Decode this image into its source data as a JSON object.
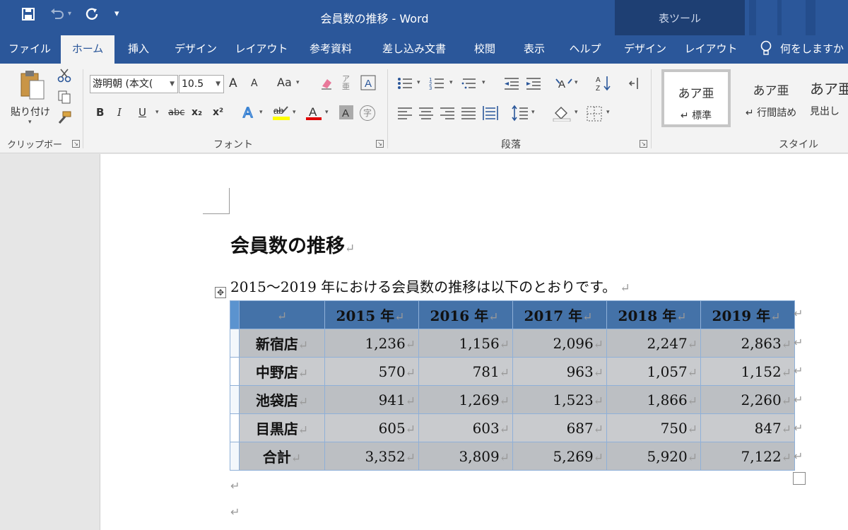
{
  "window": {
    "title": "会員数の推移  -  Word",
    "table_tools_label": "表ツール",
    "quick_access": {
      "save_icon": "save-icon",
      "undo_icon": "undo-icon",
      "redo_icon": "redo-icon",
      "customize_icon": "customize-icon"
    }
  },
  "tabs": [
    "ファイル",
    "ホーム",
    "挿入",
    "デザイン",
    "レイアウト",
    "参考資料",
    "差し込み文書",
    "校閲",
    "表示",
    "ヘルプ",
    "デザイン",
    "レイアウト"
  ],
  "active_tab": "ホーム",
  "tell_me": "何をしますか",
  "ribbon": {
    "clipboard": {
      "paste_label": "貼り付け",
      "group_label": "クリップボード"
    },
    "font": {
      "font_name": "游明朝 (本文(",
      "font_size": "10.5",
      "group_label": "フォント",
      "grow": "A",
      "shrink": "A",
      "change_case": "Aa",
      "bold": "B",
      "italic": "I",
      "underline": "U",
      "strike": "abc",
      "subscript": "x₂",
      "superscript": "x²",
      "enclose": "字",
      "font_color": "A",
      "highlight": "ab"
    },
    "paragraph": {
      "group_label": "段落"
    },
    "styles": {
      "group_label": "スタイル",
      "items": [
        {
          "sample": "あア亜",
          "name": "↵ 標準"
        },
        {
          "sample": "あア亜",
          "name": "↵ 行間詰め"
        },
        {
          "sample": "あア亜",
          "name": "見出し"
        }
      ]
    }
  },
  "document": {
    "heading": "会員数の推移",
    "paragraph": "2015～2019 年における会員数の推移は以下のとおりです。",
    "table": {
      "headers": [
        "",
        "2015 年",
        "2016 年",
        "2017 年",
        "2018 年",
        "2019 年"
      ],
      "rows": [
        {
          "label": "新宿店",
          "values": [
            "1,236",
            "1,156",
            "2,096",
            "2,247",
            "2,863"
          ]
        },
        {
          "label": "中野店",
          "values": [
            "570",
            "781",
            "963",
            "1,057",
            "1,152"
          ]
        },
        {
          "label": "池袋店",
          "values": [
            "941",
            "1,269",
            "1,523",
            "1,866",
            "2,260"
          ]
        },
        {
          "label": "目黒店",
          "values": [
            "605",
            "603",
            "687",
            "750",
            "847"
          ]
        },
        {
          "label": "合計",
          "values": [
            "3,352",
            "3,809",
            "5,269",
            "5,920",
            "7,122"
          ]
        }
      ]
    }
  },
  "colors": {
    "title_bar": "#2b579a",
    "table_header": "#4472a8",
    "table_body": "#bcbfc3"
  }
}
